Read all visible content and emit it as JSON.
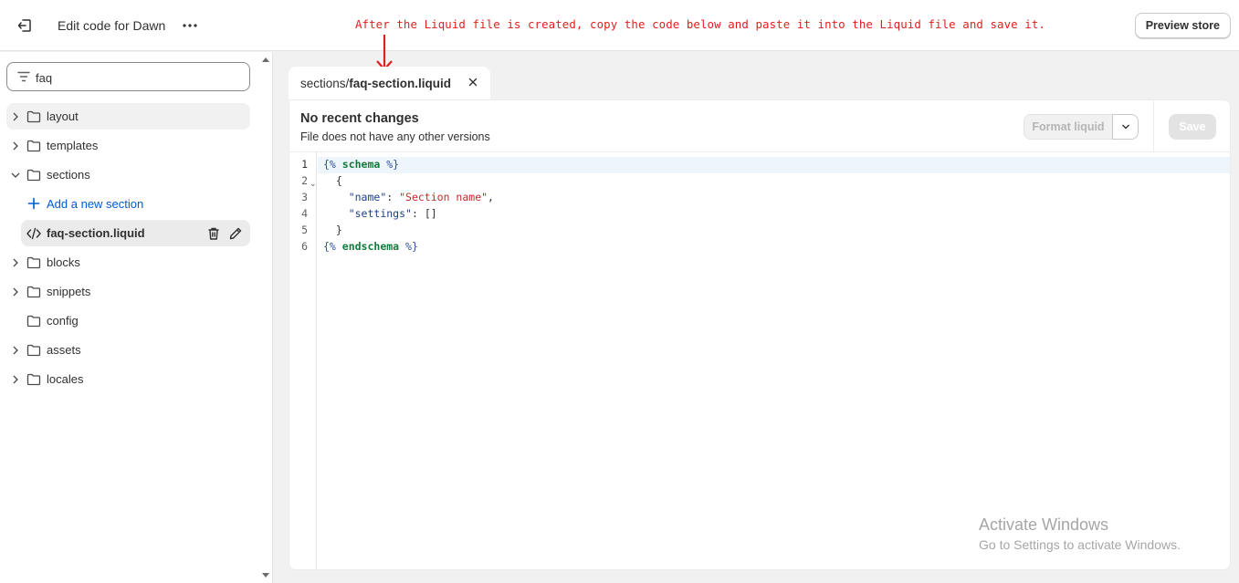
{
  "header": {
    "title": "Edit code for Dawn",
    "more_label": "•••",
    "preview_label": "Preview store"
  },
  "annotation": {
    "text": "After the Liquid file is created, copy the code below and paste it into the Liquid file and save it.",
    "color": "#e0201f"
  },
  "sidebar": {
    "search_value": "faq",
    "items": [
      {
        "label": "layout"
      },
      {
        "label": "templates"
      },
      {
        "label": "sections"
      },
      {
        "label": "Add a new section"
      },
      {
        "label": "faq-section.liquid"
      },
      {
        "label": "blocks"
      },
      {
        "label": "snippets"
      },
      {
        "label": "config"
      },
      {
        "label": "assets"
      },
      {
        "label": "locales"
      }
    ]
  },
  "editor": {
    "tab_path": "sections/",
    "tab_file": "faq-section.liquid",
    "changes_title": "No recent changes",
    "changes_sub": "File does not have any other versions",
    "format_label": "Format liquid",
    "save_label": "Save",
    "line_numbers": [
      "1",
      "2",
      "3",
      "4",
      "5",
      "6"
    ],
    "code": {
      "l1_open": "{% ",
      "l1_kw": "schema",
      "l1_close": " %}",
      "l2": "  {",
      "l3_indent": "    ",
      "l3_key": "\"name\"",
      "l3_sep": ": ",
      "l3_val": "\"Section name\"",
      "l3_end": ",",
      "l4_indent": "    ",
      "l4_key": "\"settings\"",
      "l4_sep": ": ",
      "l4_val": "[]",
      "l5": "  }",
      "l6_open": "{% ",
      "l6_kw": "endschema",
      "l6_close": " %}"
    }
  },
  "watermark": {
    "line1": "Activate Windows",
    "line2": "Go to Settings to activate Windows."
  },
  "colors": {
    "accent_link": "#005bd3",
    "annotation": "#e0201f"
  }
}
